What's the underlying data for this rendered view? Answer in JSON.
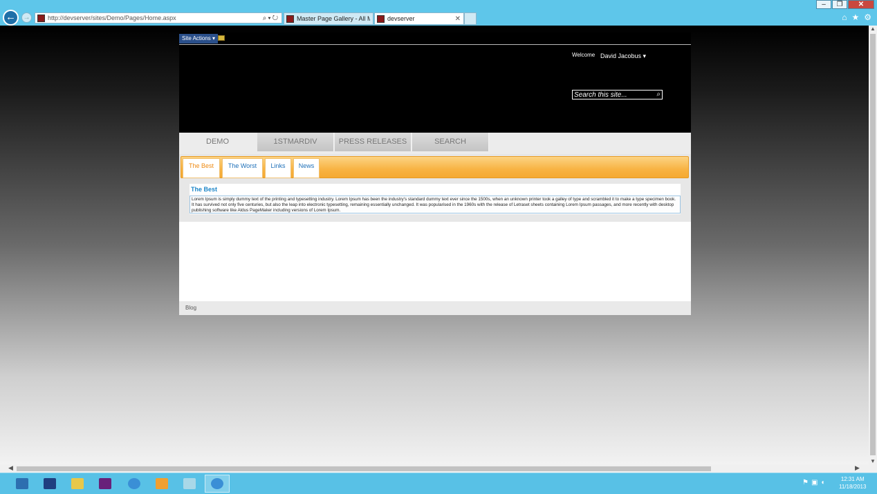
{
  "browser": {
    "address": "http://devserver/sites/Demo/Pages/Home.aspx",
    "tabs": [
      {
        "label": "Master Page Gallery - All Mast...",
        "active": false
      },
      {
        "label": "devserver",
        "active": true
      }
    ],
    "window_buttons": {
      "minimize": "–",
      "restore": "❐",
      "close": "✕"
    }
  },
  "sharepoint": {
    "site_actions": "Site Actions ▾",
    "welcome_label": "Welcome",
    "user_name": "David Jacobus ▾",
    "search_placeholder": "Search this site...",
    "top_nav": [
      "DEMO",
      "1STMARDIV",
      "PRESS RELEASES",
      "SEARCH"
    ],
    "sub_tabs": [
      "The Best",
      "The Worst",
      "Links",
      "News"
    ],
    "panel": {
      "title": "The Best",
      "body": "Lorem Ipsum is simply dummy text of the printing and typesetting industry. Lorem Ipsum has been the industry's standard dummy text ever since the 1500s, when an unknown printer took a galley of type and scrambled it to make a type specimen book. It has survived not only five centuries, but also the leap into electronic typesetting, remaining essentially unchanged. It was popularised in the 1960s with the release of Letraset sheets containing Lorem Ipsum passages, and more recently with desktop publishing software like Aldus PageMaker including versions of Lorem Ipsum."
    },
    "footer_link": "Blog"
  },
  "taskbar": {
    "time": "12:31 AM",
    "date": "11/18/2013"
  },
  "colors": {
    "chrome": "#5ec6ea",
    "tab_accent": "#f8b343",
    "link_blue": "#1d6fb8",
    "active_tab_orange": "#ee8a12"
  }
}
